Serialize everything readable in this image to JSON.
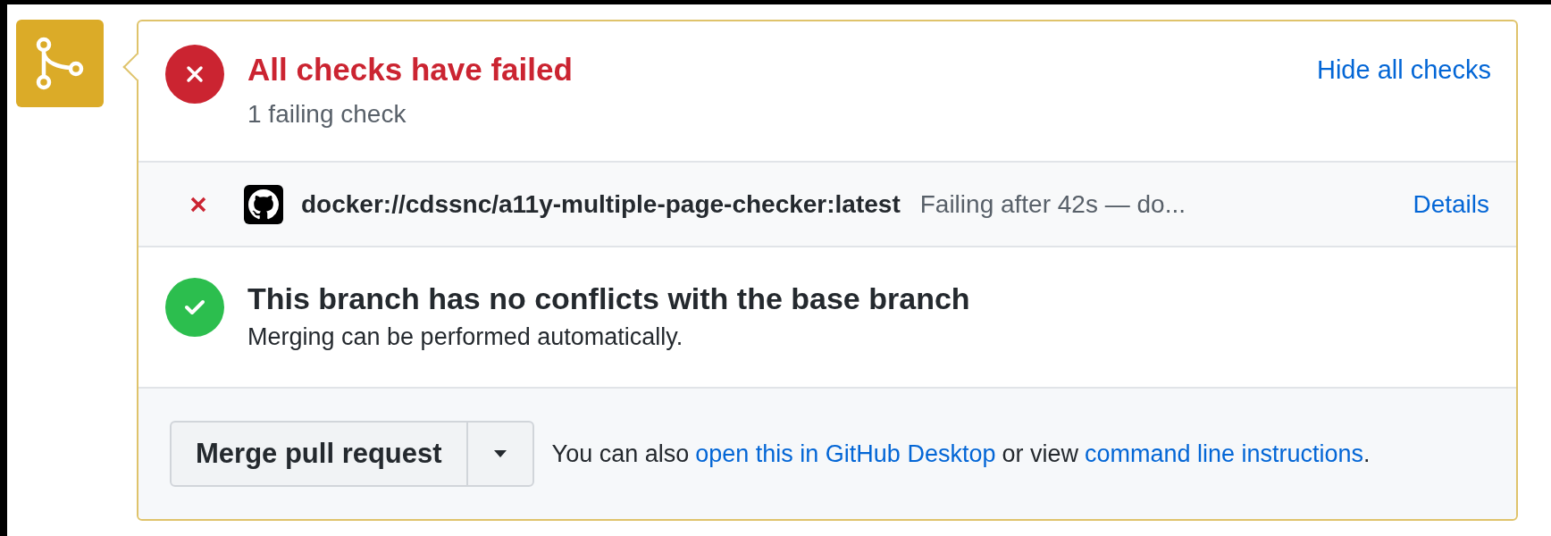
{
  "checks_header": {
    "passed": false,
    "title": "All checks have failed",
    "subtitle": "1 failing check",
    "toggle_link": "Hide all checks"
  },
  "checks": [
    {
      "passed": false,
      "name": "docker://cdssnc/a11y-multiple-page-checker:latest",
      "description": "Failing after 42s — do...",
      "link": "Details"
    }
  ],
  "merge_status": {
    "passed": true,
    "title": "This branch has no conflicts with the base branch",
    "subtitle": "Merging can be performed automatically."
  },
  "merge_box": {
    "button": "Merge pull request",
    "hint_prefix": "You can also",
    "desktop_link": "open this in GitHub Desktop",
    "hint_middle": "or view",
    "cli_link": "command line instructions",
    "hint_suffix": "."
  }
}
